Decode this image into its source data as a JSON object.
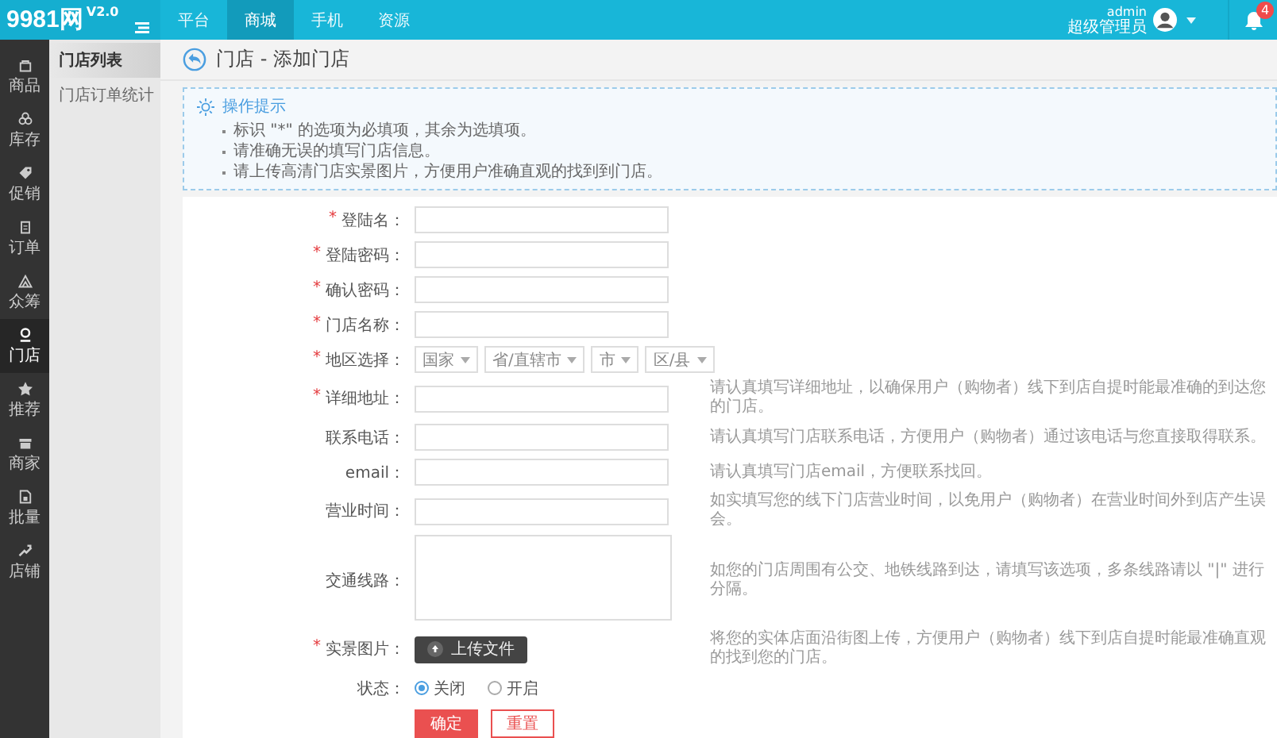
{
  "topbar": {
    "logo": "9981网",
    "version": "V2.0",
    "nav": [
      {
        "label": "平台",
        "selected": false
      },
      {
        "label": "商城",
        "selected": true
      },
      {
        "label": "手机",
        "selected": false
      },
      {
        "label": "资源",
        "selected": false
      }
    ],
    "user": {
      "name": "admin",
      "role": "超级管理员"
    },
    "notifications": "4"
  },
  "sidebar": {
    "items": [
      {
        "label": "商品",
        "selected": false
      },
      {
        "label": "库存",
        "selected": false
      },
      {
        "label": "促销",
        "selected": false
      },
      {
        "label": "订单",
        "selected": false
      },
      {
        "label": "众筹",
        "selected": false
      },
      {
        "label": "门店",
        "selected": true
      },
      {
        "label": "推荐",
        "selected": false
      },
      {
        "label": "商家",
        "selected": false
      },
      {
        "label": "批量",
        "selected": false
      },
      {
        "label": "店铺",
        "selected": false
      }
    ]
  },
  "submenu": {
    "items": [
      {
        "label": "门店列表",
        "selected": true
      },
      {
        "label": "门店订单统计",
        "selected": false
      }
    ]
  },
  "page_title": "门店 - 添加门店",
  "tips": {
    "title": "操作提示",
    "items": [
      "标识 \"*\" 的选项为必填项，其余为选填项。",
      "请准确无误的填写门店信息。",
      "请上传高清门店实景图片，方便用户准确直观的找到到门店。"
    ]
  },
  "form": {
    "fields": [
      {
        "kind": "input",
        "label": "登陆名：",
        "required_mark": "*"
      },
      {
        "kind": "input",
        "label": "登陆密码：",
        "required_mark": "*"
      },
      {
        "kind": "input",
        "label": "确认密码：",
        "required_mark": "*"
      },
      {
        "kind": "input",
        "label": "门店名称：",
        "required_mark": "*"
      },
      {
        "kind": "selects",
        "label": "地区选择：",
        "required_mark": "*",
        "options": [
          "国家",
          "省/直辖市",
          "市",
          "区/县"
        ]
      },
      {
        "kind": "input",
        "label": "详细地址：",
        "required_mark": "*",
        "hint": "请认真填写详细地址，以确保用户（购物者）线下到店自提时能最准确的到达您的门店。"
      },
      {
        "kind": "input",
        "label": "联系电话：",
        "hint": "请认真填写门店联系电话，方便用户（购物者）通过该电话与您直接取得联系。"
      },
      {
        "kind": "input",
        "label": "email：",
        "hint": "请认真填写门店email，方便联系找回。"
      },
      {
        "kind": "input",
        "label": "营业时间：",
        "hint": "如实填写您的线下门店营业时间，以免用户（购物者）在营业时间外到店产生误会。"
      },
      {
        "kind": "textarea",
        "label": "交通线路：",
        "hint": "如您的门店周围有公交、地铁线路到达，请填写该选项，多条线路请以 \"|\" 进行分隔。"
      },
      {
        "kind": "upload",
        "label": "实景图片：",
        "required_mark": "*",
        "button": "上传文件",
        "hint": "将您的实体店面沿街图上传，方便用户（购物者）线下到店自提时能最准确直观的找到您的门店。"
      },
      {
        "kind": "radio",
        "label": "状态：",
        "options": [
          {
            "label": "关闭",
            "selected": true
          },
          {
            "label": "开启",
            "selected": false
          }
        ]
      }
    ],
    "buttons": [
      {
        "kind": "primary",
        "label": "确定"
      },
      {
        "kind": "secondary",
        "label": "重置"
      }
    ]
  }
}
